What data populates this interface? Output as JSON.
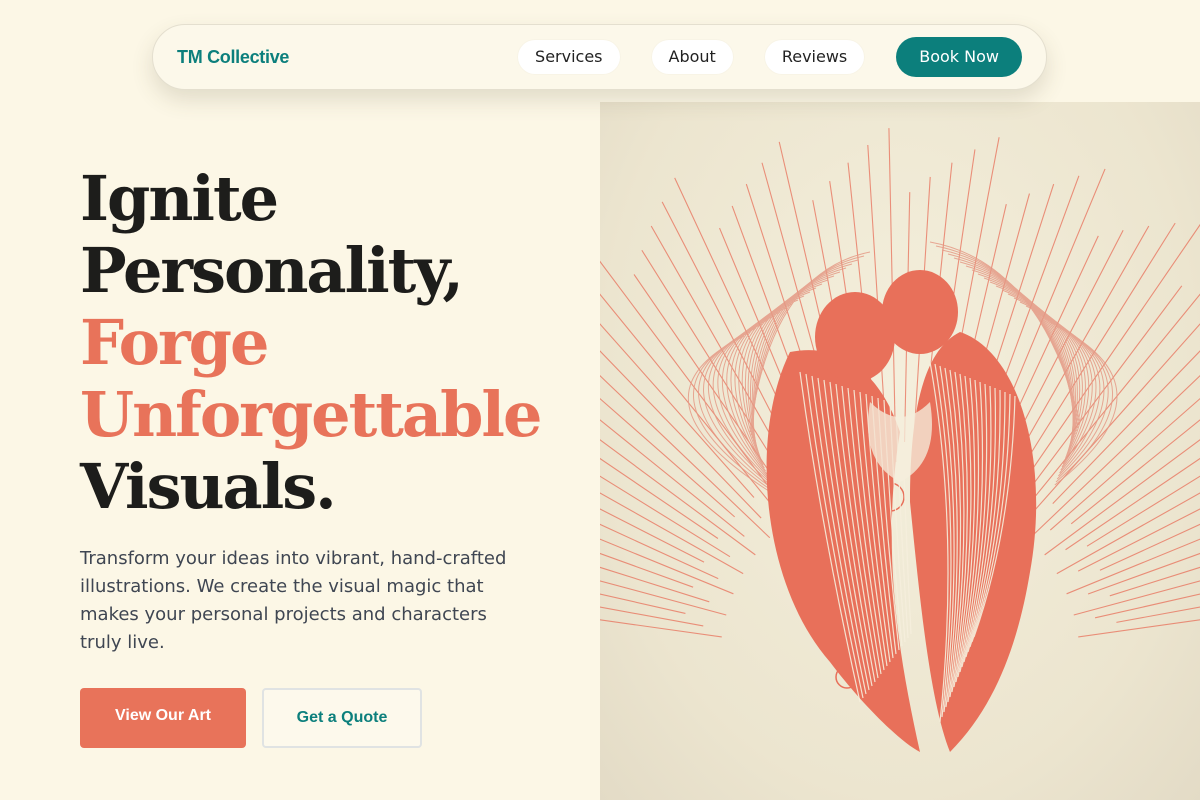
{
  "nav": {
    "brand": "TM Collective",
    "links": [
      "Services",
      "About",
      "Reviews"
    ],
    "cta": "Book Now"
  },
  "hero": {
    "title_lines": [
      "Ignite",
      "Personality,"
    ],
    "accent_lines": [
      "Forge",
      "Unforgettable"
    ],
    "final_line": "Visuals.",
    "description": "Transform your ideas into vibrant, hand-crafted illustrations. We create the visual magic that makes your personal projects and characters truly live.",
    "primary_button": "View Our Art",
    "secondary_button": "Get a Quote"
  },
  "artwork": {
    "icon": "angels-illustration",
    "stroke_color": "#e8705a"
  },
  "colors": {
    "background": "#fcf7e6",
    "accent": "#e8735a",
    "brand": "#0c7f7c"
  }
}
